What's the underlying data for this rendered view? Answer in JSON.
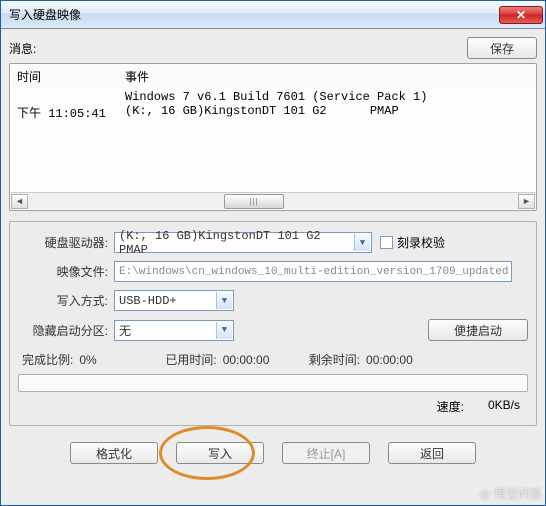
{
  "window": {
    "title": "写入硬盘映像"
  },
  "top": {
    "message_label": "消息:",
    "save_btn": "保存"
  },
  "log": {
    "header_time": "时间",
    "header_event": "事件",
    "rows": [
      {
        "time": "",
        "event": "Windows 7 v6.1 Build 7601 (Service Pack 1)"
      },
      {
        "time": "下午 11:05:41",
        "event": "(K:, 16 GB)KingstonDT 101 G2      PMAP"
      }
    ],
    "thumb_grip": "|||"
  },
  "form": {
    "drive_label": "硬盘驱动器:",
    "drive_value": "(K:, 16 GB)KingstonDT 101 G2      PMAP",
    "verify_label": "刻录校验",
    "image_label": "映像文件:",
    "image_value": "E:\\windows\\cn_windows_10_multi-edition_version_1709_updated",
    "method_label": "写入方式:",
    "method_value": "USB-HDD+",
    "hidden_label": "隐藏启动分区:",
    "hidden_value": "无",
    "convenient_btn": "便捷启动"
  },
  "status": {
    "done_label": "完成比例:",
    "done_value": "0%",
    "elapsed_label": "已用时间:",
    "elapsed_value": "00:00:00",
    "remain_label": "剩余时间:",
    "remain_value": "00:00:00",
    "speed_label": "速度:",
    "speed_value": "0KB/s"
  },
  "buttons": {
    "format": "格式化",
    "write": "写入",
    "abort": "终止[A]",
    "back": "返回"
  },
  "watermark": "悟空问答"
}
